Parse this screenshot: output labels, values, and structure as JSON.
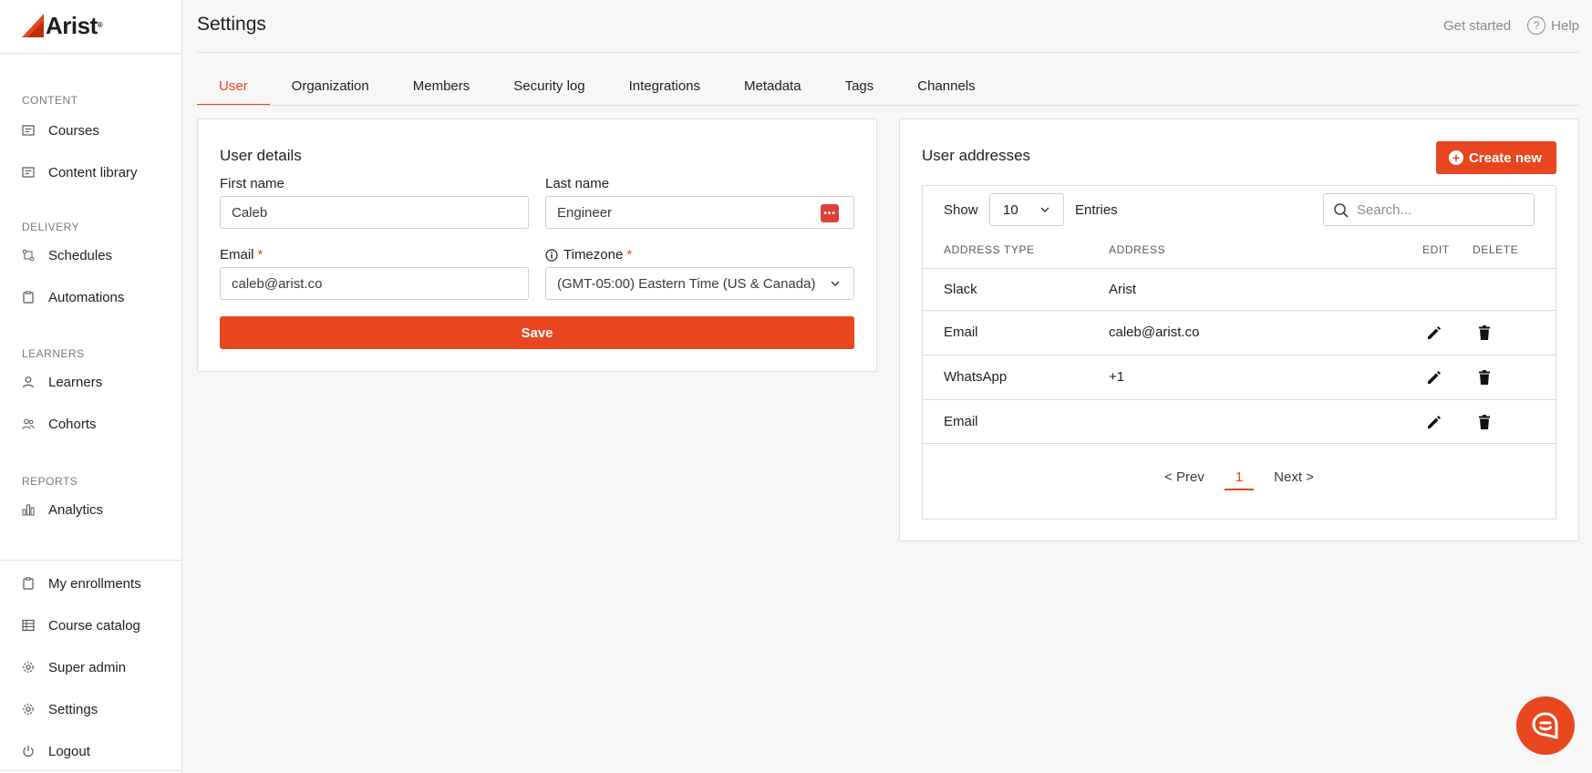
{
  "brand": {
    "name": "Arist",
    "reg": "®",
    "accent": "#e8461f"
  },
  "sidebar": {
    "sections": [
      {
        "title": "CONTENT",
        "items": [
          {
            "label": "Courses",
            "icon": "course-icon"
          },
          {
            "label": "Content library",
            "icon": "library-icon"
          }
        ]
      },
      {
        "title": "DELIVERY",
        "items": [
          {
            "label": "Schedules",
            "icon": "schedule-icon"
          },
          {
            "label": "Automations",
            "icon": "automation-icon"
          }
        ]
      },
      {
        "title": "LEARNERS",
        "items": [
          {
            "label": "Learners",
            "icon": "user-icon"
          },
          {
            "label": "Cohorts",
            "icon": "group-icon"
          }
        ]
      },
      {
        "title": "REPORTS",
        "items": [
          {
            "label": "Analytics",
            "icon": "chart-icon"
          }
        ]
      }
    ],
    "bottom_items": [
      {
        "label": "My enrollments",
        "icon": "clipboard-icon"
      },
      {
        "label": "Course catalog",
        "icon": "catalog-icon"
      },
      {
        "label": "Super admin",
        "icon": "gear-icon"
      },
      {
        "label": "Settings",
        "icon": "gear-icon"
      },
      {
        "label": "Logout",
        "icon": "power-icon"
      }
    ]
  },
  "header": {
    "title": "Settings",
    "get_started": "Get started",
    "help": "Help"
  },
  "tabs": [
    {
      "label": "User",
      "active": true
    },
    {
      "label": "Organization"
    },
    {
      "label": "Members"
    },
    {
      "label": "Security log"
    },
    {
      "label": "Integrations"
    },
    {
      "label": "Metadata"
    },
    {
      "label": "Tags"
    },
    {
      "label": "Channels"
    }
  ],
  "user_details": {
    "title": "User details",
    "first_name_label": "First name",
    "first_name_value": "Caleb",
    "last_name_label": "Last name",
    "last_name_value": "Engineer",
    "email_label": "Email",
    "email_value": "caleb@arist.co",
    "timezone_label": "Timezone",
    "timezone_value": "(GMT-05:00) Eastern Time (US & Canada)",
    "required_mark": "*",
    "save_label": "Save"
  },
  "addresses": {
    "title": "User addresses",
    "create_label": "Create new",
    "show_label": "Show",
    "show_value": "10",
    "entries_label": "Entries",
    "search_placeholder": "Search...",
    "columns": [
      "ADDRESS TYPE",
      "ADDRESS",
      "EDIT",
      "DELETE"
    ],
    "rows": [
      {
        "type": "Slack",
        "address": "Arist",
        "editable": false
      },
      {
        "type": "Email",
        "address": "caleb@arist.co",
        "editable": true
      },
      {
        "type": "WhatsApp",
        "address": "+1",
        "editable": true
      },
      {
        "type": "Email",
        "address": "",
        "editable": true
      }
    ],
    "pager": {
      "prev": "< Prev",
      "current": "1",
      "next": "Next >"
    }
  }
}
